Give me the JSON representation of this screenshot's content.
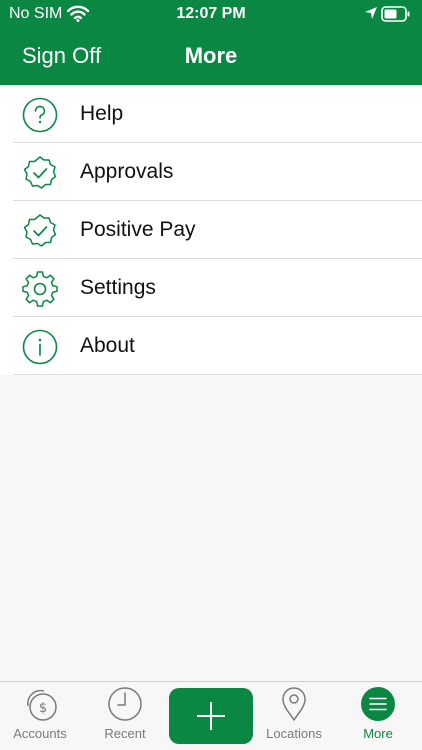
{
  "status_bar": {
    "carrier": "No SIM",
    "time": "12:07 PM"
  },
  "nav": {
    "left_button": "Sign Off",
    "title": "More"
  },
  "menu": {
    "items": [
      {
        "label": "Help",
        "icon": "help-icon"
      },
      {
        "label": "Approvals",
        "icon": "check-badge-icon"
      },
      {
        "label": "Positive Pay",
        "icon": "check-badge-icon"
      },
      {
        "label": "Settings",
        "icon": "gear-icon"
      },
      {
        "label": "About",
        "icon": "info-icon"
      }
    ]
  },
  "tab_bar": {
    "tabs": [
      {
        "label": "Accounts",
        "icon": "accounts-icon"
      },
      {
        "label": "Recent",
        "icon": "clock-icon"
      },
      {
        "label": "",
        "icon": "plus-icon"
      },
      {
        "label": "Locations",
        "icon": "location-pin-icon"
      },
      {
        "label": "More",
        "icon": "menu-icon"
      }
    ],
    "active": "More"
  },
  "colors": {
    "brand_green": "#0a8843",
    "inactive_gray": "#7a7a7a"
  }
}
